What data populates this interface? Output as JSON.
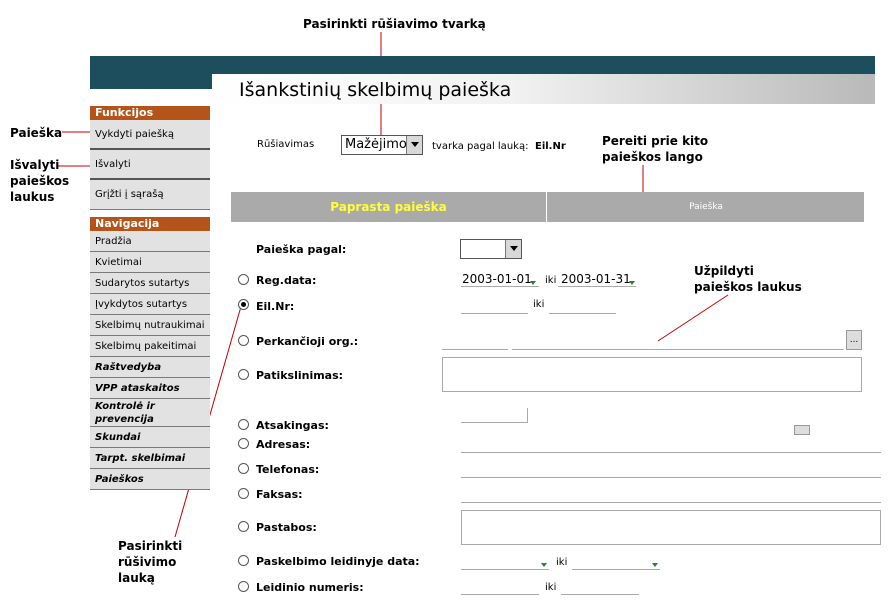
{
  "callouts": {
    "sort_order": "Pasirinkti rūšiavimo tvarką",
    "next_window": "Pereiti prie kito paieškos lango",
    "search": "Paieška",
    "clear": "Išvalyti paieškos laukus",
    "fill": "Užpildyti paieškos laukus",
    "sort_field": "Pasirinkti rūšivimo lauką"
  },
  "page": {
    "title": "Išankstinių skelbimų paieška"
  },
  "sidebar": {
    "functions_header": "Funkcijos",
    "functions": [
      "Vykdyti paiešką",
      "Išvalyti",
      "Grįžti į sąrašą"
    ],
    "nav_header": "Navigacija",
    "nav": [
      "Pradžia",
      "Kvietimai",
      "Sudarytos sutartys",
      "Įvykdytos sutartys",
      "Skelbimų nutraukimai",
      "Skelbimų pakeitimai"
    ],
    "sections": [
      "Raštvedyba",
      "VPP ataskaitos",
      "Kontrolė ir prevencija",
      "Skundai",
      "Tarpt. skelbimai",
      "Paieškos"
    ]
  },
  "sort": {
    "label": "Rūšiavimas",
    "value": "Mažėjimo",
    "order_text": "tvarka pagal lauką:",
    "field": "Eil.Nr"
  },
  "tabs": {
    "simple": "Paprasta paieška",
    "search": "Paieška"
  },
  "form": {
    "search_by": "Paieška pagal:",
    "reg_date": "Reg.data:",
    "date_from": "2003-01-01",
    "date_to": "2003-01-31",
    "iki": "iki",
    "eil_nr": "Eil.Nr:",
    "buyer": "Perkančioji org.:",
    "browse": "...",
    "details": "Patikslinimas:",
    "responsible": "Atsakingas:",
    "address": "Adresas:",
    "phone": "Telefonas:",
    "fax": "Faksas:",
    "notes": "Pastabos:",
    "pub_date": "Paskelbimo leidinyje data:",
    "issue_no": "Leidinio numeris:"
  }
}
